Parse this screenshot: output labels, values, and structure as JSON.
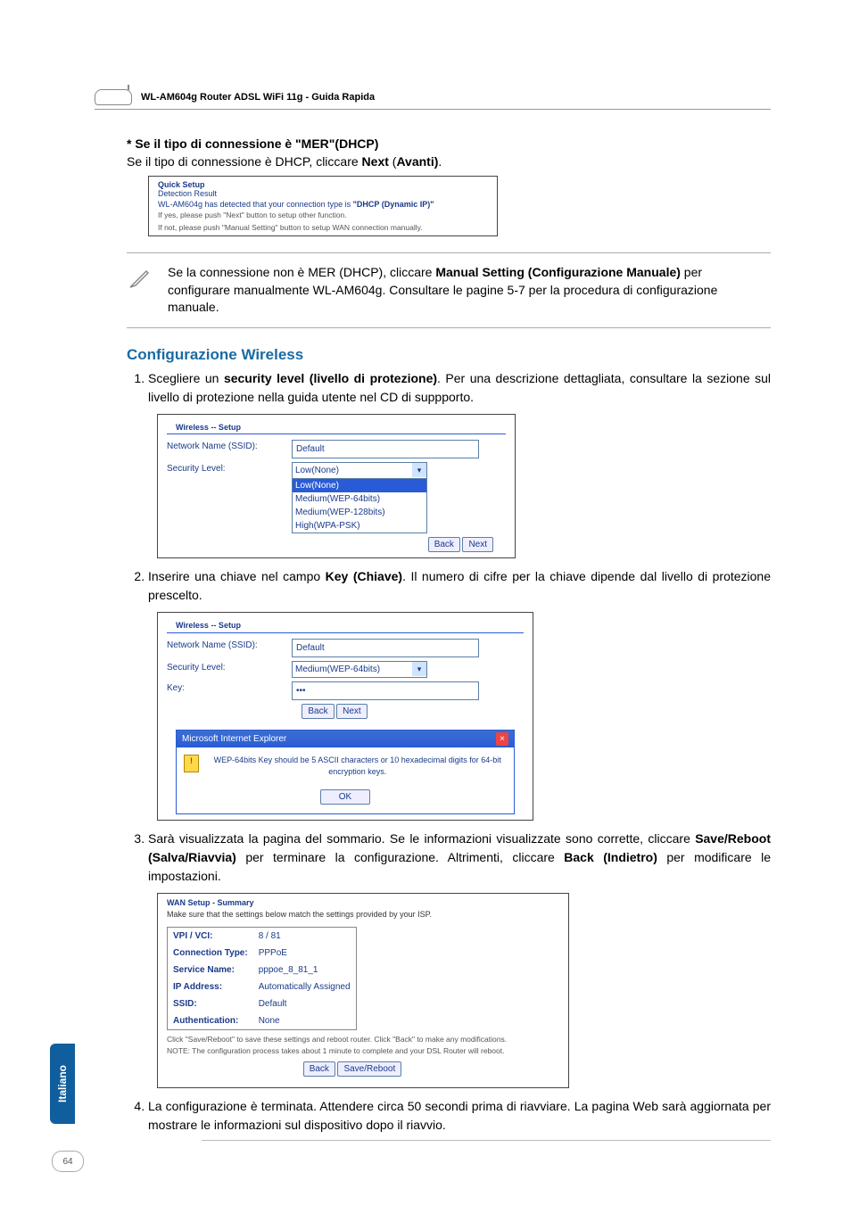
{
  "header": {
    "title": "WL-AM604g Router ADSL WiFi 11g - Guida Rapida"
  },
  "mer": {
    "heading": "* Se il tipo di connessione è \"MER\"(DHCP)",
    "line_pre": "Se il tipo di connessione è DHCP, cliccare ",
    "next": "Next",
    "paren": " (",
    "avanti": "Avanti)",
    "dot": "."
  },
  "shot1": {
    "t1": "Quick Setup",
    "t2": "Detection Result",
    "t3a": "WL-AM604g has detected that your connection type is ",
    "t3b": "\"DHCP (Dynamic IP)\"",
    "t4a": "If yes, please push \"Next\" button to setup other function.",
    "t4b": "If not, please push \"Manual Setting\" button to setup WAN connection manually."
  },
  "note": {
    "p1a": "Se la connessione non è MER (DHCP), cliccare ",
    "p1b": "Manual Setting (Configurazione Manuale)",
    "p1c": " per configurare manualmente WL-AM604g. Consultare le pagine 5-7 per la procedura di configurazione manuale."
  },
  "wireless_h": "Configurazione Wireless",
  "step1": {
    "a": "Scegliere un ",
    "b": "security level (livello di protezione)",
    "c": ". Per una descrizione dettagliata, consultare la sezione sul livello di protezione nella guida utente nel CD di suppporto."
  },
  "shotW1": {
    "title": "Wireless -- Setup",
    "ssid_lbl": "Network Name (SSID):",
    "ssid_val": "Default",
    "sec_lbl": "Security Level:",
    "sel": "Low(None)",
    "opts": [
      "Low(None)",
      "Medium(WEP-64bits)",
      "Medium(WEP-128bits)",
      "High(WPA-PSK)"
    ],
    "back": "Back",
    "next": "Next"
  },
  "step2": {
    "a": "Inserire una chiave nel campo ",
    "b": "Key (Chiave)",
    "c": ". Il numero di cifre per la chiave dipende dal livello di protezione prescelto."
  },
  "shotW2": {
    "title": "Wireless -- Setup",
    "ssid_lbl": "Network Name (SSID):",
    "ssid_val": "Default",
    "sec_lbl": "Security Level:",
    "sec_val": "Medium(WEP-64bits)",
    "key_lbl": "Key:",
    "key_val": "•••",
    "back": "Back",
    "next": "Next",
    "dlg_title": "Microsoft Internet Explorer",
    "dlg_msg": "WEP-64bits Key should be 5 ASCII characters or 10 hexadecimal digits for 64-bit encryption keys.",
    "dlg_ok": "OK"
  },
  "step3": {
    "a": "Sarà visualizzata la pagina del sommario. Se le informazioni visualizzate sono corrette, cliccare ",
    "b": "Save/Reboot (Salva/Riavvia)",
    "c": " per terminare la configurazione. Altrimenti, cliccare ",
    "d": "Back (Indietro)",
    "e": " per modificare le impostazioni."
  },
  "shotSum": {
    "title": "WAN Setup - Summary",
    "sub": "Make sure that the settings below match the settings provided by your ISP.",
    "rows": [
      {
        "l": "VPI / VCI:",
        "v": "8 / 81"
      },
      {
        "l": "Connection Type:",
        "v": "PPPoE"
      },
      {
        "l": "Service Name:",
        "v": "pppoe_8_81_1"
      },
      {
        "l": "IP Address:",
        "v": "Automatically Assigned"
      },
      {
        "l": "SSID:",
        "v": "Default"
      },
      {
        "l": "Authentication:",
        "v": "None"
      }
    ],
    "note": "Click \"Save/Reboot\" to save these settings and reboot router. Click \"Back\" to make any modifications.\nNOTE: The configuration process takes about 1 minute to complete and your DSL Router will reboot.",
    "back": "Back",
    "save": "Save/Reboot"
  },
  "step4": "La configurazione è terminata. Attendere circa 50 secondi prima di riavviare. La pagina Web sarà aggiornata per mostrare le informazioni sul dispositivo dopo il riavvio.",
  "lang_tab": "Italiano",
  "page_num": "64"
}
